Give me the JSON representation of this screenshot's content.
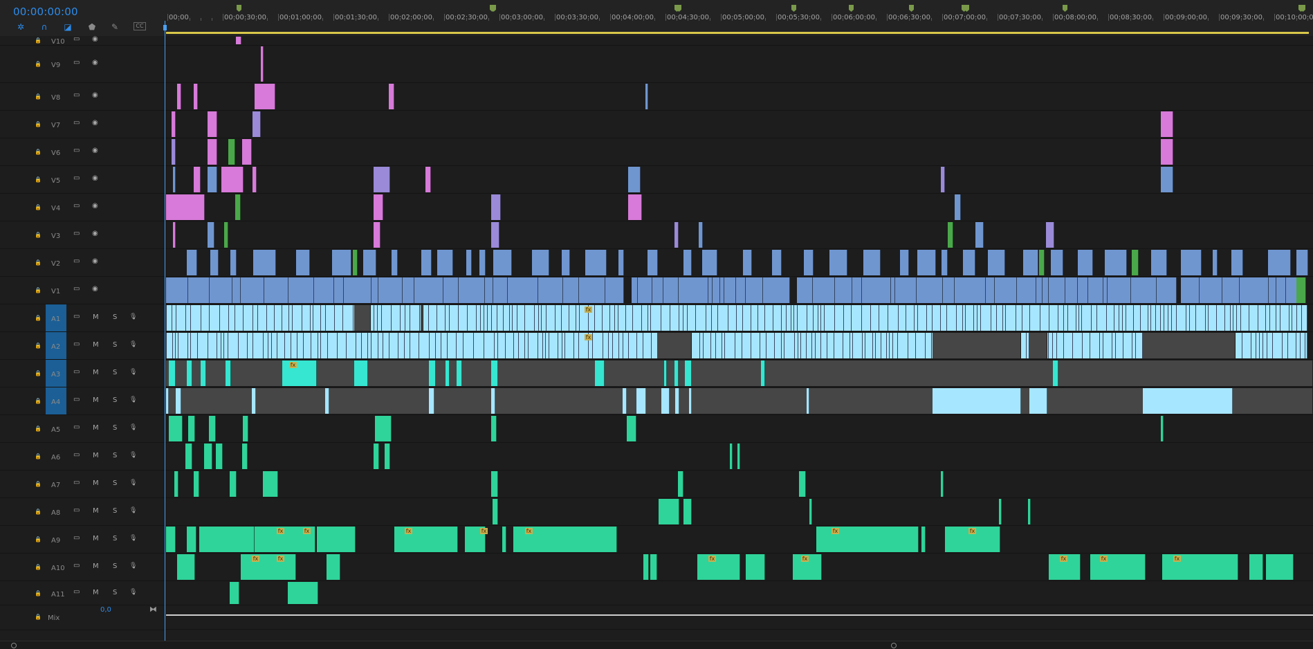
{
  "timecode": "00:00:00:00",
  "tools": [
    {
      "icon": "snap-icon"
    },
    {
      "icon": "linked-selection-icon"
    },
    {
      "icon": "sequence-markers-icon"
    },
    {
      "icon": "add-marker-icon"
    },
    {
      "icon": "wrench-icon"
    },
    {
      "icon": "captions-icon",
      "label": "CC"
    }
  ],
  "ruler_labels": [
    "00:00",
    "00:00:30:00",
    "00:01:00:00",
    "00:01:30:00",
    "00:02:00:00",
    "00:02:30:00",
    "00:03:00:00",
    "00:03:30:00",
    "00:04:00:00",
    "00:04:30:00",
    "00:05:00:00",
    "00:05:30:00",
    "00:06:00:00",
    "00:06:30:00",
    "00:07:00:00",
    "00:07:30:00",
    "00:08:00:00",
    "00:08:30:00",
    "00:09:00:00",
    "00:09:30:00",
    "00:10:00:00"
  ],
  "video_tracks": [
    "V10",
    "V9",
    "V8",
    "V7",
    "V6",
    "V5",
    "V4",
    "V3",
    "V2",
    "V1"
  ],
  "audio_tracks": [
    "A1",
    "A2",
    "A3",
    "A4",
    "A5",
    "A6",
    "A7",
    "A8",
    "A9",
    "A10",
    "A11"
  ],
  "audio_buttons": {
    "mute": "M",
    "solo": "S"
  },
  "mix": {
    "label": "Mix",
    "value": "0,0"
  },
  "colors": {
    "accent": "#2d8ceb",
    "clip_blue": "#7096d0",
    "clip_pink": "#d77ad9",
    "clip_purple": "#9a8ad8",
    "clip_green": "#4aa84a",
    "audio_lightblue": "#a6e6ff",
    "audio_cyan": "#36e6d0",
    "audio_green": "#2fd49a",
    "gap_grey": "#464646"
  }
}
